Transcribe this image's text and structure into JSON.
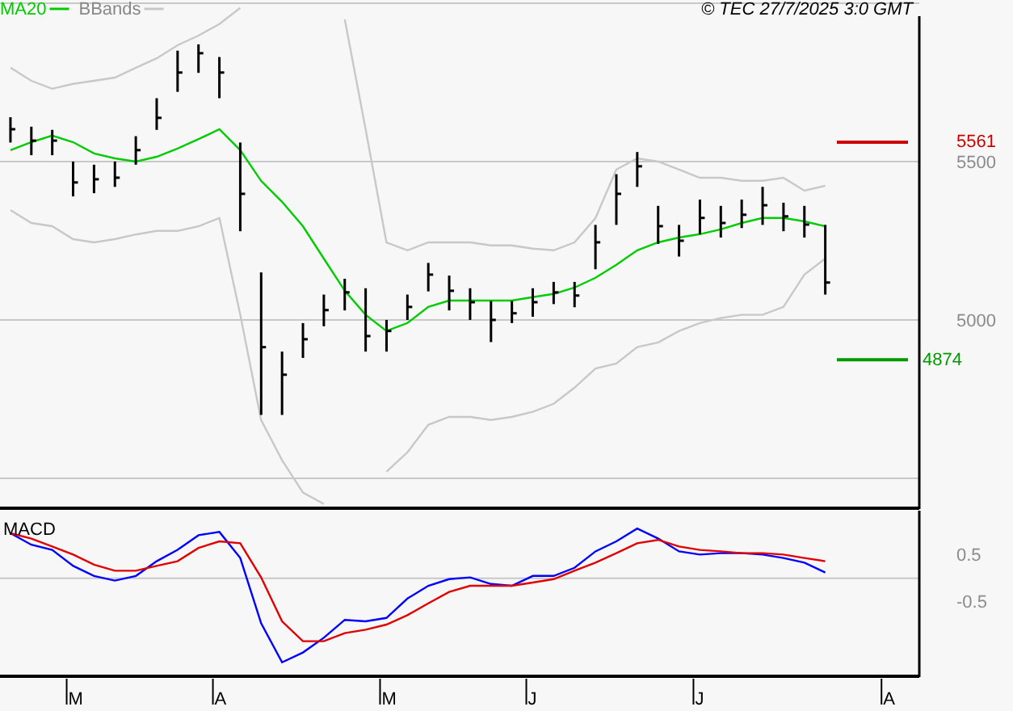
{
  "copyright": "© TEC 27/7/2025 3:0 GMT",
  "price_chart": {
    "chart_data": {
      "type": "line",
      "legend": "upper left",
      "categories": [
        null,
        null,
        null,
        null,
        null,
        null,
        null,
        null,
        null,
        null,
        null,
        null,
        null,
        null,
        null,
        null,
        null,
        null,
        null,
        null,
        null,
        null,
        null,
        null,
        null,
        null,
        null,
        null,
        null,
        null,
        null,
        null,
        null,
        null,
        null,
        null,
        null,
        null,
        null,
        null,
        null,
        null,
        null,
        null
      ],
      "ylim": [
        4403,
        6010
      ],
      "yticks": [
        5000,
        5500
      ],
      "series": [
        {
          "name": "MA20",
          "color": "#00cc00",
          "values": [
            5536,
            5561,
            5582,
            5561,
            5526,
            5510,
            5500,
            5515,
            5541,
            5571,
            5602,
            5536,
            5439,
            5373,
            5296,
            5194,
            5092,
            5016,
            4965,
            4990,
            5041,
            5061,
            5061,
            5061,
            5061,
            5072,
            5082,
            5102,
            5133,
            5174,
            5220,
            5245,
            5260,
            5271,
            5286,
            5306,
            5322,
            5322,
            5311,
            5296,
            null,
            null,
            null,
            null
          ]
        },
        {
          "name": "BBands",
          "color": "#c8c8c8",
          "values": [
            5796,
            5755,
            5730,
            5745,
            5755,
            5765,
            5796,
            5826,
            5867,
            5898,
            5934,
            5985,
            null,
            null,
            null,
            null,
            5949,
            5602,
            5245,
            5220,
            5245,
            5245,
            5245,
            5235,
            5235,
            5225,
            5220,
            5245,
            5322,
            5475,
            5510,
            5500,
            5475,
            5449,
            5449,
            5439,
            5439,
            5449,
            5408,
            5424,
            null,
            null,
            null,
            null
          ]
        },
        {
          "color": "#c8c8c8",
          "values": [
            5347,
            5306,
            5296,
            5255,
            5245,
            5255,
            5270,
            5281,
            5281,
            5296,
            5322,
            5016,
            4684,
            4557,
            4455,
            4419,
            null,
            null,
            4521,
            4582,
            4669,
            4694,
            4694,
            4684,
            4694,
            4710,
            4735,
            4786,
            4847,
            4862,
            4914,
            4929,
            4965,
            4990,
            5006,
            5016,
            5016,
            5041,
            5143,
            5194,
            null,
            null,
            null,
            null
          ]
        }
      ]
    },
    "levels": [
      {
        "label": "5561",
        "color": "#cc0000"
      },
      {
        "label": "4874",
        "color": "#009900"
      }
    ]
  },
  "macd_chart": {
    "chart_data": {
      "type": "line",
      "categories": [
        null,
        null,
        null,
        "M",
        null,
        null,
        null,
        null,
        null,
        null,
        "A",
        null,
        null,
        null,
        null,
        null,
        null,
        null,
        "M",
        null,
        null,
        null,
        null,
        null,
        null,
        "J",
        null,
        null,
        null,
        null,
        null,
        null,
        null,
        "J",
        null,
        null,
        null,
        null,
        null,
        null,
        null,
        null,
        "A",
        null
      ],
      "ylim": [
        -2.09,
        1.43
      ],
      "yticks": [
        0.5,
        -0.5
      ],
      "series": [
        {
          "name": "MACD",
          "color": "#0000ff",
          "values": [
            0.95,
            0.71,
            0.6,
            0.26,
            0.05,
            -0.05,
            0.05,
            0.36,
            0.6,
            0.91,
            0.98,
            0.43,
            -0.95,
            -1.78,
            -1.57,
            -1.26,
            -0.88,
            -0.91,
            -0.84,
            -0.43,
            -0.16,
            -0.02,
            0.02,
            -0.12,
            -0.16,
            0.05,
            0.05,
            0.22,
            0.57,
            0.78,
            1.05,
            0.84,
            0.57,
            0.5,
            0.53,
            0.53,
            0.5,
            0.43,
            0.33,
            0.12,
            null,
            null,
            null,
            null
          ]
        },
        {
          "color": "#e00000",
          "values": [
            0.95,
            0.84,
            0.67,
            0.5,
            0.29,
            0.16,
            0.16,
            0.26,
            0.36,
            0.64,
            0.78,
            0.74,
            0.02,
            -0.91,
            -1.33,
            -1.33,
            -1.16,
            -1.09,
            -0.98,
            -0.78,
            -0.53,
            -0.29,
            -0.16,
            -0.16,
            -0.16,
            -0.09,
            -0.02,
            0.16,
            0.33,
            0.53,
            0.74,
            0.81,
            0.67,
            0.6,
            0.57,
            0.53,
            0.53,
            0.5,
            0.43,
            0.36,
            null,
            null,
            null,
            null
          ]
        }
      ]
    }
  }
}
